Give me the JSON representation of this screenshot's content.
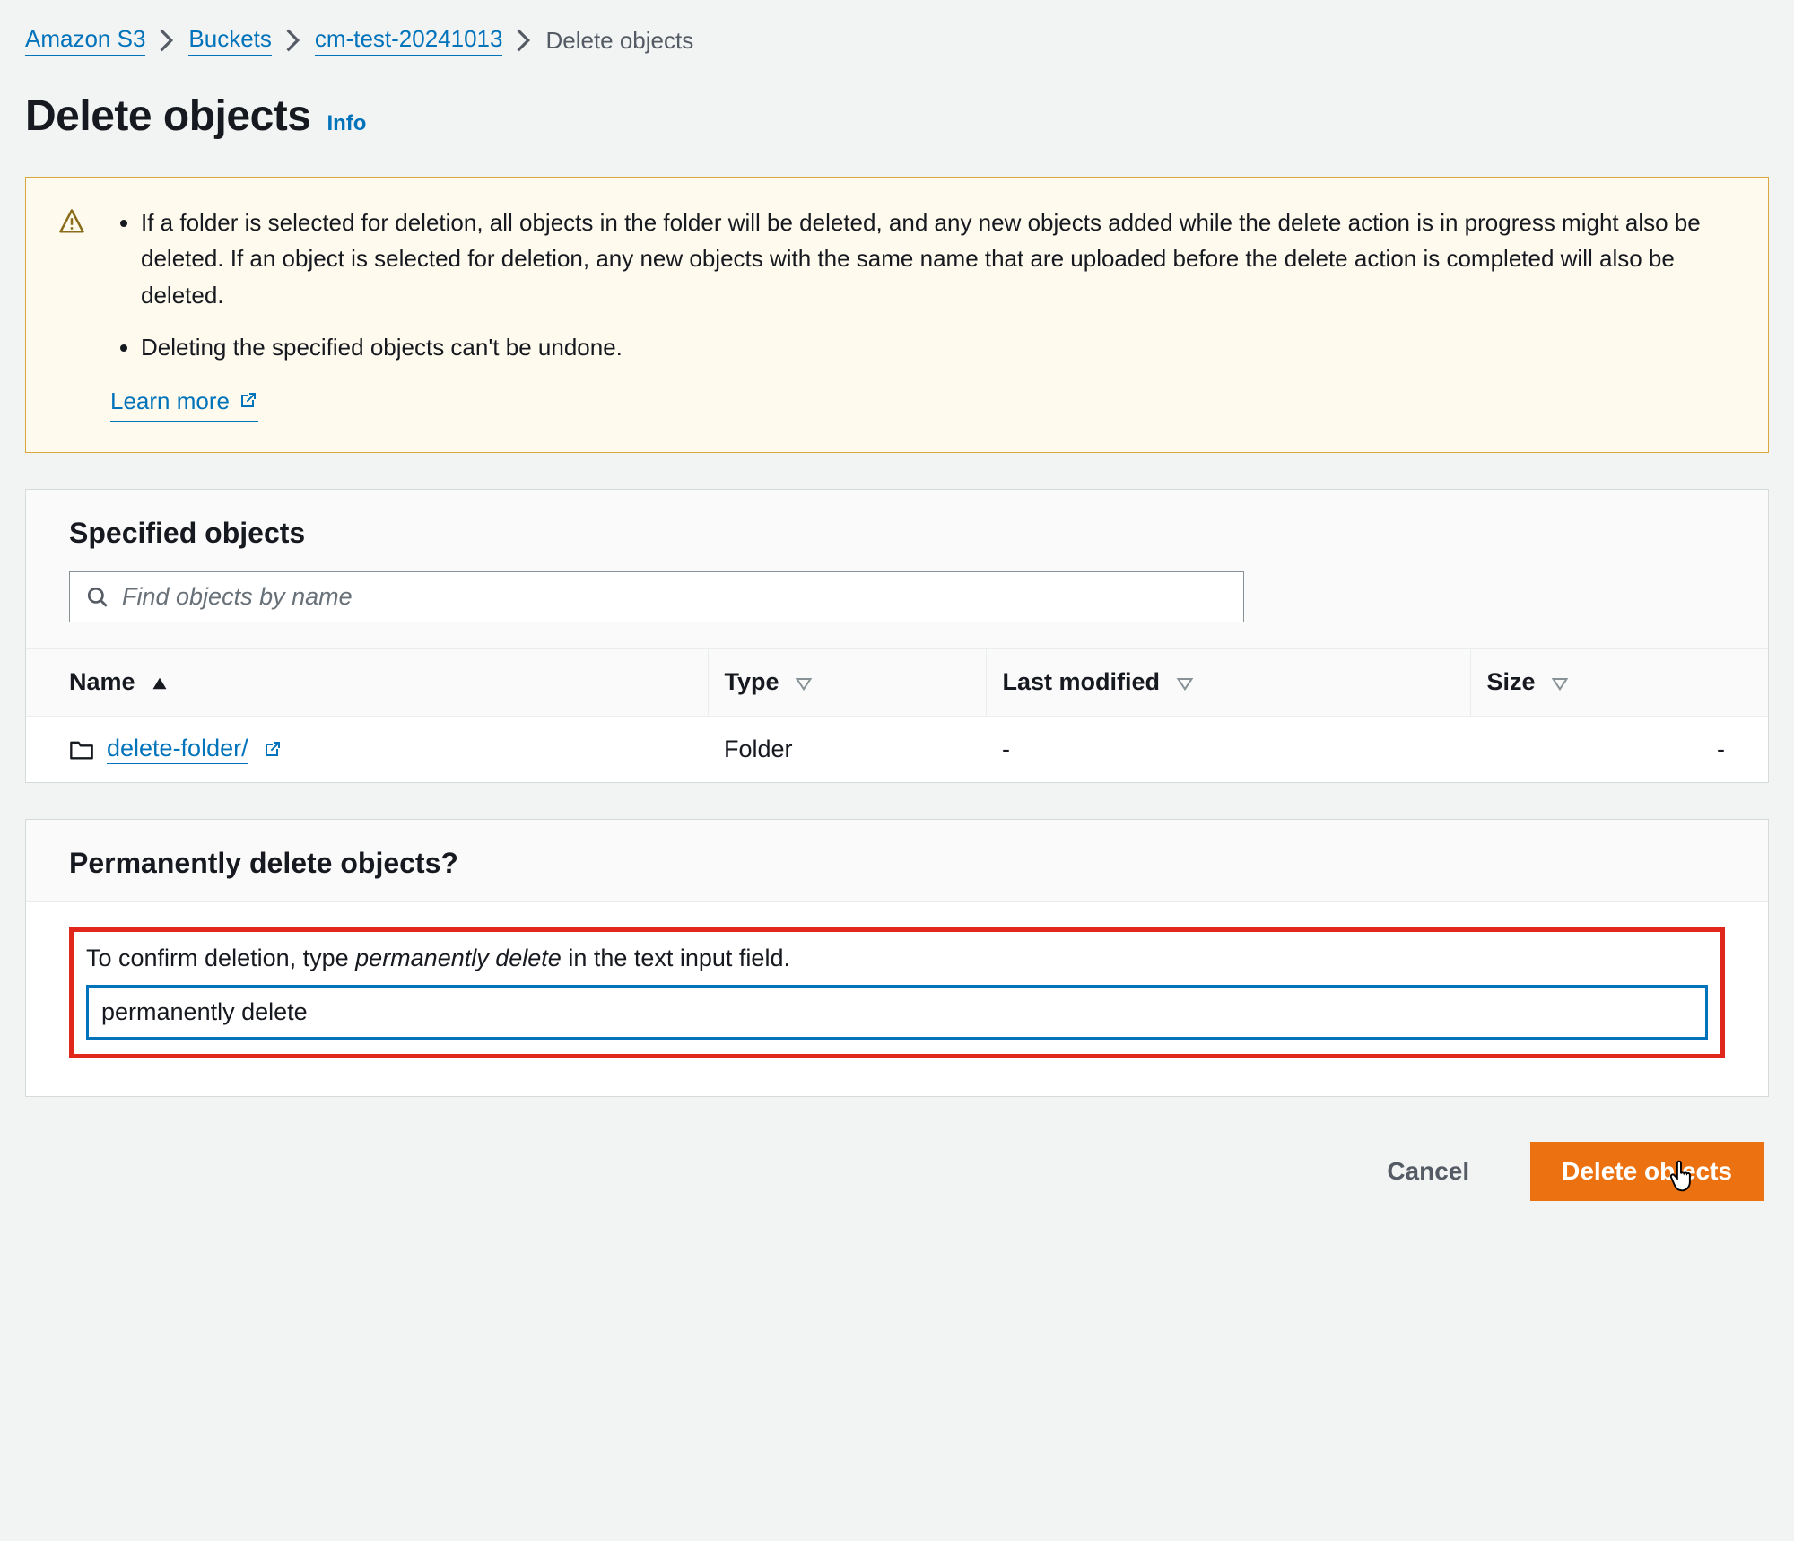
{
  "breadcrumb": {
    "items": [
      {
        "label": "Amazon S3",
        "link": true
      },
      {
        "label": "Buckets",
        "link": true
      },
      {
        "label": "cm-test-20241013",
        "link": true
      },
      {
        "label": "Delete objects",
        "link": false
      }
    ]
  },
  "page": {
    "title": "Delete objects",
    "info_label": "Info"
  },
  "notice": {
    "bullets": [
      "If a folder is selected for deletion, all objects in the folder will be deleted, and any new objects added while the delete action is in progress might also be deleted. If an object is selected for deletion, any new objects with the same name that are uploaded before the delete action is completed will also be deleted.",
      "Deleting the specified objects can't be undone."
    ],
    "learn_more": "Learn more"
  },
  "specified": {
    "title": "Specified objects",
    "search_placeholder": "Find objects by name",
    "columns": {
      "name": "Name",
      "type": "Type",
      "last_modified": "Last modified",
      "size": "Size"
    },
    "rows": [
      {
        "name": "delete-folder/",
        "type": "Folder",
        "last_modified": "-",
        "size": "-"
      }
    ]
  },
  "confirm": {
    "title": "Permanently delete objects?",
    "instruction_pre": "To confirm deletion, type ",
    "instruction_em": "permanently delete",
    "instruction_post": " in the text input field.",
    "input_value": "permanently delete"
  },
  "footer": {
    "cancel": "Cancel",
    "delete": "Delete objects"
  }
}
